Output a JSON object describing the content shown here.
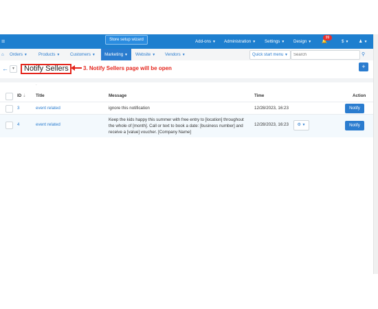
{
  "topbar": {
    "left_icon": "≡",
    "wizard_label": "Store setup wizard",
    "items": [
      "Add-ons",
      "Administration",
      "Settings",
      "Design"
    ],
    "bell_badge": "99",
    "currency": "$",
    "user": "👤"
  },
  "nav": {
    "items": [
      "Orders",
      "Products",
      "Customers"
    ],
    "active": "Marketing",
    "after": [
      "Website",
      "Vendors"
    ],
    "quick_start": "Quick start menu",
    "search_placeholder": "Search"
  },
  "page": {
    "title": "Notify Sellers",
    "annotation": "3. Notify Sellers page will be open",
    "dot": "·"
  },
  "table": {
    "headers": {
      "id": "ID",
      "title": "Title",
      "message": "Message",
      "time": "Time",
      "action": "Action"
    },
    "rows": [
      {
        "id": "3",
        "title": "event related",
        "message": "ignore this notification",
        "time": "12/28/2023, 16:23",
        "action": "Notify"
      },
      {
        "id": "4",
        "title": "event related",
        "message": "Keep the kids happy this summer with free entry to [location] throughout the whole of [month]. Call or text to book a date: [business number] and receive a [value] voucher. [Company Name]",
        "time": "12/28/2023, 16:23",
        "action": "Notify"
      }
    ]
  },
  "colors": {
    "accent": "#2a7ccf",
    "topbar": "#1e7fcf",
    "annotation": "#e4241b"
  }
}
